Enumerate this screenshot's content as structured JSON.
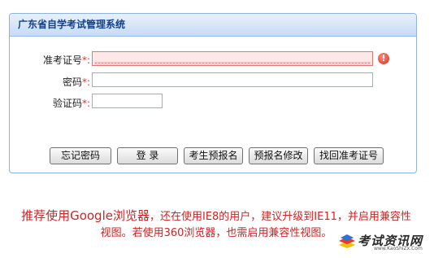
{
  "panel": {
    "title": "广东省自学考试管理系统"
  },
  "form": {
    "fields": [
      {
        "label": "准考证号",
        "required": "*:",
        "value": "",
        "state": "invalid"
      },
      {
        "label": "密码",
        "required": "*:",
        "value": ""
      },
      {
        "label": "验证码",
        "required": "*:",
        "value": ""
      }
    ],
    "error_icon": "!"
  },
  "buttons": [
    {
      "label": "忘记密码"
    },
    {
      "label": "登 录"
    },
    {
      "label": "考生预报名"
    },
    {
      "label": "预报名修改"
    },
    {
      "label": "找回准考证号"
    }
  ],
  "notice": {
    "lead": "推荐使用Google浏览器",
    "rest": "，还在使用IE8的用户，建议升级到IE11，并启用兼容性视图。若使用360浏览器，也需启用兼容性视图。"
  },
  "watermark": {
    "text": "考试资讯网",
    "url": "www.KaoShiZx.Com"
  },
  "colors": {
    "header_text": "#15428b",
    "notice": "#d22222",
    "required": "#e03030"
  }
}
